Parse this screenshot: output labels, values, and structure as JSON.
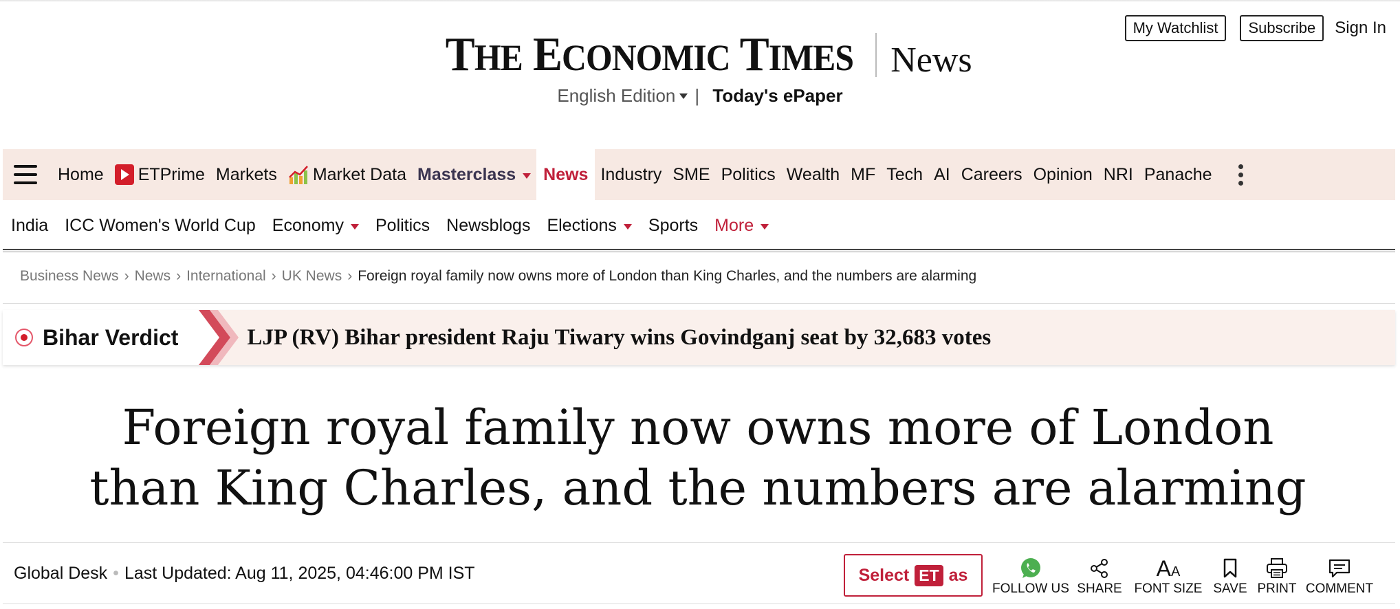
{
  "header": {
    "logo_text": "The Economic Times",
    "section_title": "News",
    "edition_label": "English Edition",
    "edition_separator": "|",
    "epaper_label": "Today's ePaper",
    "watchlist_label": "My Watchlist",
    "subscribe_label": "Subscribe",
    "signin_label": "Sign In"
  },
  "main_nav": {
    "items": [
      "Home",
      "ETPrime",
      "Markets",
      "Market Data",
      "Masterclass",
      "News",
      "Industry",
      "SME",
      "Politics",
      "Wealth",
      "MF",
      "Tech",
      "AI",
      "Careers",
      "Opinion",
      "NRI",
      "Panache"
    ],
    "active": "News",
    "accent_color": "#c0203a"
  },
  "sub_nav": {
    "items": [
      "India",
      "ICC Women's World Cup",
      "Economy",
      "Politics",
      "Newsblogs",
      "Elections",
      "Sports",
      "More"
    ]
  },
  "breadcrumb": {
    "items": [
      "Business News",
      "News",
      "International",
      "UK News"
    ],
    "separator": "›",
    "current": "Foreign royal family now owns more of London than King Charles, and the numbers are alarming"
  },
  "banner": {
    "label": "Bihar Verdict",
    "text": "LJP (RV) Bihar president Raju Tiwary wins Govindganj seat by 32,683 votes"
  },
  "article": {
    "headline": "Foreign royal family now owns more of London than King Charles, and the numbers are alarming",
    "author": "Global Desk",
    "updated": "Last Updated: Aug 11, 2025, 04:46:00 PM IST"
  },
  "actions": {
    "select_prefix": "Select",
    "select_badge": "ET",
    "select_suffix": "as",
    "tools": [
      {
        "label": "FOLLOW US",
        "icon": "whatsapp-icon"
      },
      {
        "label": "SHARE",
        "icon": "share-icon"
      },
      {
        "label": "FONT SIZE",
        "icon": "font-size-icon"
      },
      {
        "label": "SAVE",
        "icon": "bookmark-icon"
      },
      {
        "label": "PRINT",
        "icon": "printer-icon"
      },
      {
        "label": "COMMENT",
        "icon": "comment-icon"
      }
    ]
  }
}
